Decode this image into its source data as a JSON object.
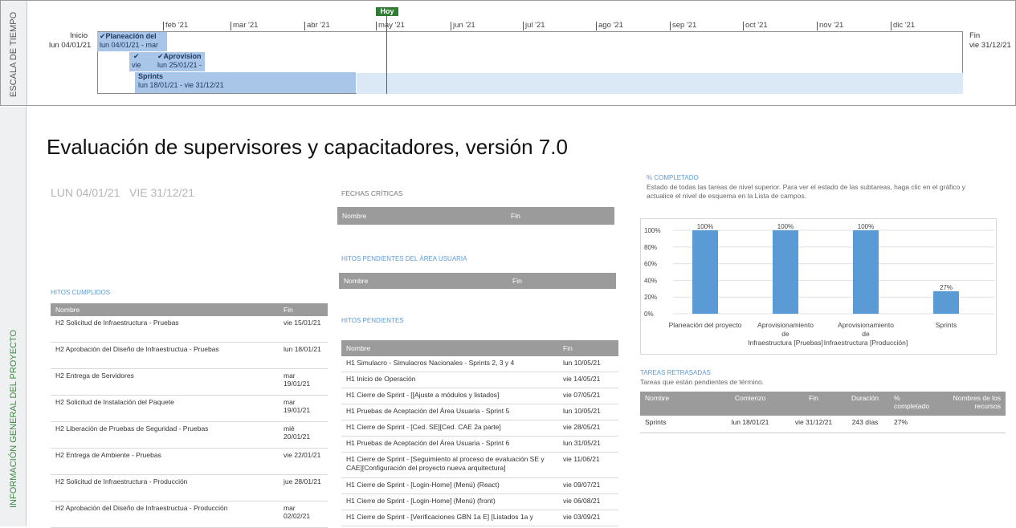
{
  "timeline": {
    "side_label": "ESCALA DE TIEMPO",
    "today": "Hoy",
    "start_label": "Inicio",
    "start_date": "lun 04/01/21",
    "end_label": "Fin",
    "end_date": "vie 31/12/21",
    "months": [
      "feb '21",
      "mar '21",
      "abr '21",
      "may '21",
      "jun '21",
      "jul '21",
      "ago '21",
      "sep '21",
      "oct '21",
      "nov '21",
      "dic '21"
    ],
    "tasks": [
      {
        "name": "Planeación del",
        "dates": "lun 04/01/21 - mar"
      },
      {
        "check": "vie",
        "name": "Aprovision",
        "dates": "lun 25/01/21 -"
      },
      {
        "name": "Sprints",
        "dates": "lun 18/01/21 - vie 31/12/21"
      }
    ]
  },
  "overview": {
    "side_label": "INFORMACIÓN GENERAL DEL PROYECTO",
    "title": "Evaluación de supervisores y capacitadores, versión 7.0",
    "dates": "LUN 04/01/21   VIE 31/12/21",
    "hitos_cumplidos": {
      "label": "HITOS CUMPLIDOS",
      "headers": [
        "Nombre",
        "Fin"
      ],
      "rows": [
        [
          "H2 Solicitud de Infraestructura - Pruebas",
          "vie 15/01/21"
        ],
        [
          "H2 Aprobación del Diseño de Infraestructua - Pruebas",
          "lun 18/01/21"
        ],
        [
          "H2 Entrega de Servidores",
          "mar 19/01/21"
        ],
        [
          "H2 Solicitud de Instalación del Paquete",
          "mar 19/01/21"
        ],
        [
          "H2 Liberación de Pruebas de Seguridad - Pruebas",
          "mié 20/01/21"
        ],
        [
          "H2 Entrega de Ambiente - Pruebas",
          "vie 22/01/21"
        ],
        [
          "H2 Solicitud de Infraestructura - Producción",
          "jue 28/01/21"
        ],
        [
          "H2 Aprobación del Diseño de Infraestructua - Producción",
          "mar 02/02/21"
        ]
      ]
    },
    "fechas_criticas": {
      "label": "FECHAS CRÍTICAS",
      "headers": [
        "Nombre",
        "Fin"
      ]
    },
    "hitos_usuaria": {
      "label": "HITOS PENDIENTES DEL ÁREA USUARIA",
      "headers": [
        "Nombre",
        "Fin"
      ]
    },
    "hitos_pendientes": {
      "label": "HITOS PENDIENTES",
      "headers": [
        "Nombre",
        "Fin"
      ],
      "rows": [
        [
          "H1 Simulacro - Simulacros Nacionales - Sprints 2, 3 y 4",
          "lun 10/05/21"
        ],
        [
          "H1 Inicio de Operación",
          "vie 14/05/21"
        ],
        [
          "H1 Cierre de Sprint - [[Ajuste a módulos y listados]",
          "vie 07/05/21"
        ],
        [
          "H1 Pruebas de Aceptación del Área Usuaria - Sprint 5",
          "lun 10/05/21"
        ],
        [
          "H1 Cierre de Sprint - [Ced. SE][Ced. CAE 2a parte]",
          "vie 28/05/21"
        ],
        [
          "H1 Pruebas de Aceptación del Área Usuaria - Sprint 6",
          "lun 31/05/21"
        ],
        [
          "H1 Cierre de Sprint - [Seguimiento al proceso de evaluación SE y CAE][Configuración del proyecto nueva arquitectura]",
          "vie 11/06/21"
        ],
        [
          "H1 Cierre de Sprint - [Login-Home] (Menú) (React)",
          "vie 09/07/21"
        ],
        [
          "H1 Cierre de Sprint - [Login-Home] (Menú) (front)",
          "vie 06/08/21"
        ],
        [
          "H1 Cierre de Sprint - [Verificaciones GBN 1a E] [Listados 1a y",
          "vie 03/09/21"
        ]
      ]
    },
    "completado": {
      "label": "% COMPLETADO",
      "desc": "Estado de todas las tareas de nivel superior. Para ver el estado de las subtareas, haga clic en el gráfico y actualice el nivel de esquema en la Lista de campos."
    },
    "tareas_retrasadas": {
      "label": "TAREAS RETRASADAS",
      "desc": "Tareas que están pendientes de término.",
      "headers": [
        "Nombre",
        "Comienzo",
        "Fin",
        "Duración",
        "% completado",
        "Nombres de los recursos"
      ],
      "rows": [
        [
          "Sprints",
          "lun 18/01/21",
          "vie 31/12/21",
          "243 días",
          "27%",
          ""
        ]
      ]
    }
  },
  "chart_data": {
    "type": "bar",
    "categories": [
      "Planeación del proyecto",
      "Aprovisionamiento de Infraestructura [Pruebas]",
      "Aprovisionamiento de Infraestructura [Producción]",
      "Sprints"
    ],
    "values": [
      100,
      100,
      100,
      27
    ],
    "data_labels": [
      "100%",
      "100%",
      "100%",
      "27%"
    ],
    "yticks": [
      "0%",
      "20%",
      "40%",
      "60%",
      "80%",
      "100%"
    ],
    "ylim": [
      0,
      100
    ],
    "color": "#5b9bd5",
    "grid": true
  }
}
